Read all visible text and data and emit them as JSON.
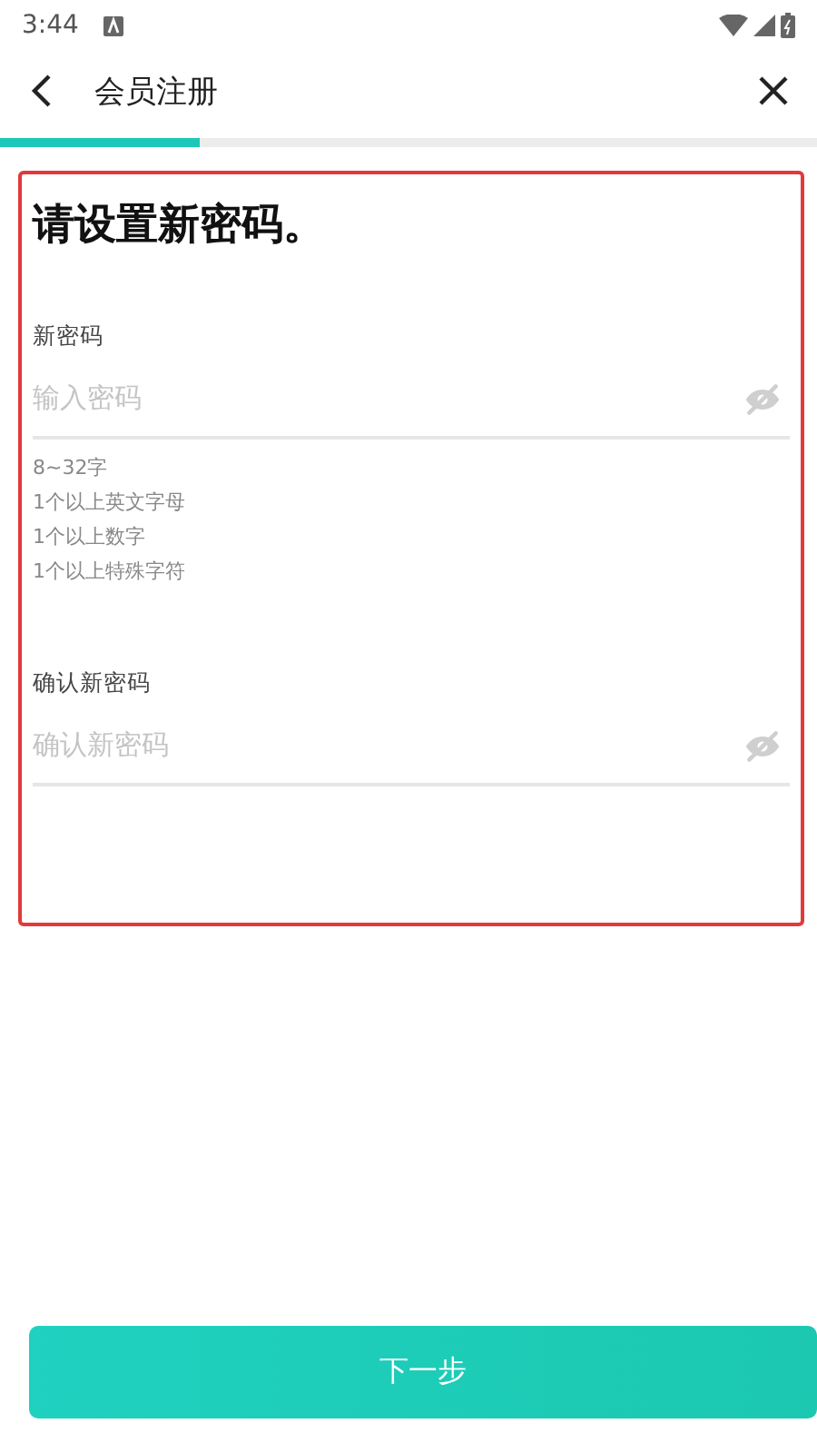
{
  "status_bar": {
    "time": "3:44"
  },
  "header": {
    "title": "会员注册"
  },
  "progress": {
    "level": 0.245
  },
  "form": {
    "heading": "请设置新密码。",
    "fields": [
      {
        "label": "新密码",
        "placeholder": "输入密码",
        "rules": [
          "8~32字",
          "1个以上英文字母",
          "1个以上数字",
          "1个以上特殊字符"
        ]
      },
      {
        "label": "确认新密码",
        "placeholder": "确认新密码"
      }
    ]
  },
  "button": {
    "label": "下一步"
  }
}
